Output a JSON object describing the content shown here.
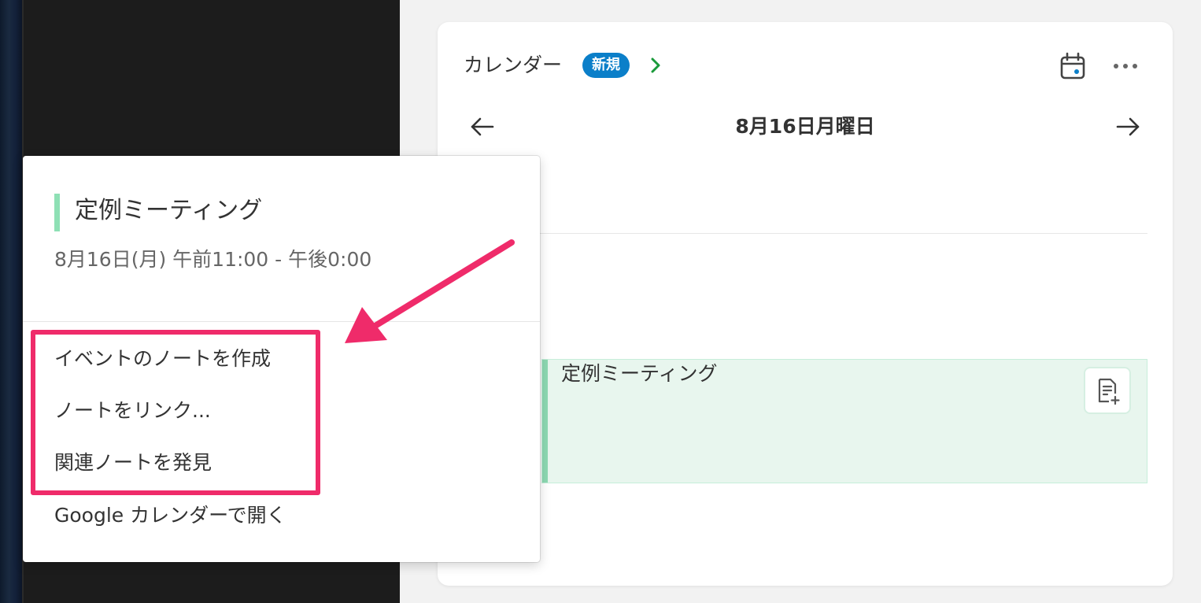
{
  "calendar": {
    "title": "カレンダー",
    "badge": "新規",
    "date": "8月16日月曜日",
    "event_title": "定例ミーティング"
  },
  "popup": {
    "event_title": "定例ミーティング",
    "time": "8月16日(月) 午前11:00 - 午後0:00",
    "menu": [
      {
        "label": "イベントのノートを作成"
      },
      {
        "label": "ノートをリンク..."
      },
      {
        "label": "関連ノートを発見"
      },
      {
        "label": "Google カレンダーで開く"
      }
    ]
  },
  "icons": {
    "chevron": "chevron-right-icon",
    "calendar": "calendar-icon",
    "more": "more-icon",
    "prev": "arrow-left-icon",
    "next": "arrow-right-icon",
    "note_add": "note-add-icon"
  },
  "colors": {
    "badge": "#0b7fc9",
    "chevron": "#1a9a3a",
    "event_bg": "#e8f6ee",
    "event_bar": "#8dd9b2",
    "annotation": "#ef2b6a"
  }
}
